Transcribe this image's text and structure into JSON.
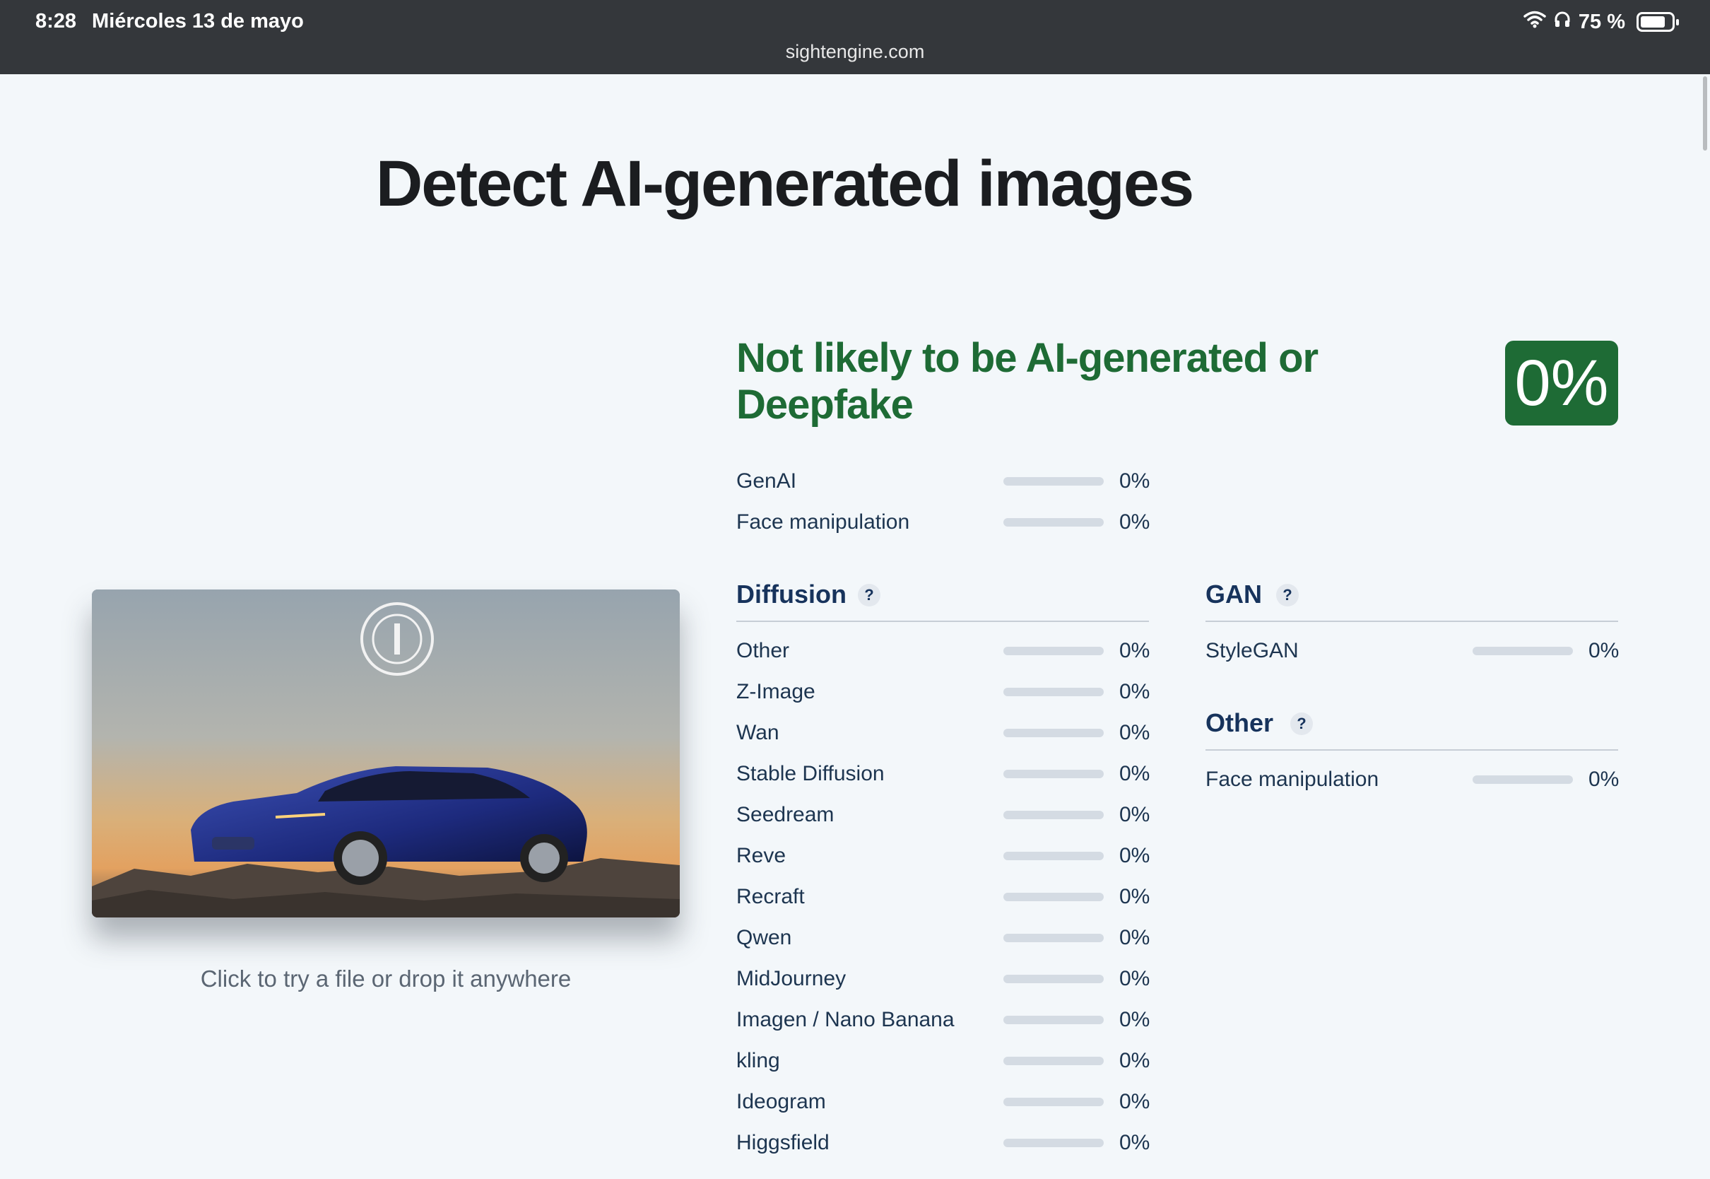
{
  "status_bar": {
    "time": "8:28",
    "date": "Miércoles 13 de mayo",
    "battery": "75 %",
    "url": "sightengine.com"
  },
  "page": {
    "title": "Detect AI-generated images",
    "drop_hint": "Click to try a file or drop it anywhere"
  },
  "result": {
    "verdict": "Not likely to be AI-generated or Deepfake",
    "score": "0%",
    "summary": [
      {
        "label": "GenAI",
        "value": "0%",
        "fill": 0
      },
      {
        "label": "Face manipulation",
        "value": "0%",
        "fill": 0
      }
    ]
  },
  "diffusion": {
    "title": "Diffusion",
    "help": "?",
    "items": [
      {
        "label": "Other",
        "value": "0%",
        "fill": 0
      },
      {
        "label": "Z-Image",
        "value": "0%",
        "fill": 0
      },
      {
        "label": "Wan",
        "value": "0%",
        "fill": 0
      },
      {
        "label": "Stable Diffusion",
        "value": "0%",
        "fill": 0
      },
      {
        "label": "Seedream",
        "value": "0%",
        "fill": 0
      },
      {
        "label": "Reve",
        "value": "0%",
        "fill": 0
      },
      {
        "label": "Recraft",
        "value": "0%",
        "fill": 0
      },
      {
        "label": "Qwen",
        "value": "0%",
        "fill": 0
      },
      {
        "label": "MidJourney",
        "value": "0%",
        "fill": 0
      },
      {
        "label": "Imagen / Nano Banana",
        "value": "0%",
        "fill": 0
      },
      {
        "label": "kling",
        "value": "0%",
        "fill": 0
      },
      {
        "label": "Ideogram",
        "value": "0%",
        "fill": 0
      },
      {
        "label": "Higgsfield",
        "value": "0%",
        "fill": 0
      }
    ]
  },
  "gan": {
    "title": "GAN",
    "help": "?",
    "items": [
      {
        "label": "StyleGAN",
        "value": "0%",
        "fill": 0
      }
    ]
  },
  "other": {
    "title": "Other",
    "help": "?",
    "items": [
      {
        "label": "Face manipulation",
        "value": "0%",
        "fill": 0
      }
    ]
  },
  "colors": {
    "verdict_green": "#1e6b35",
    "section_navy": "#17335c",
    "bar_track": "#d4dbe3"
  },
  "icons": [
    "wifi-icon",
    "headphones-icon",
    "battery-icon",
    "help-icon"
  ]
}
